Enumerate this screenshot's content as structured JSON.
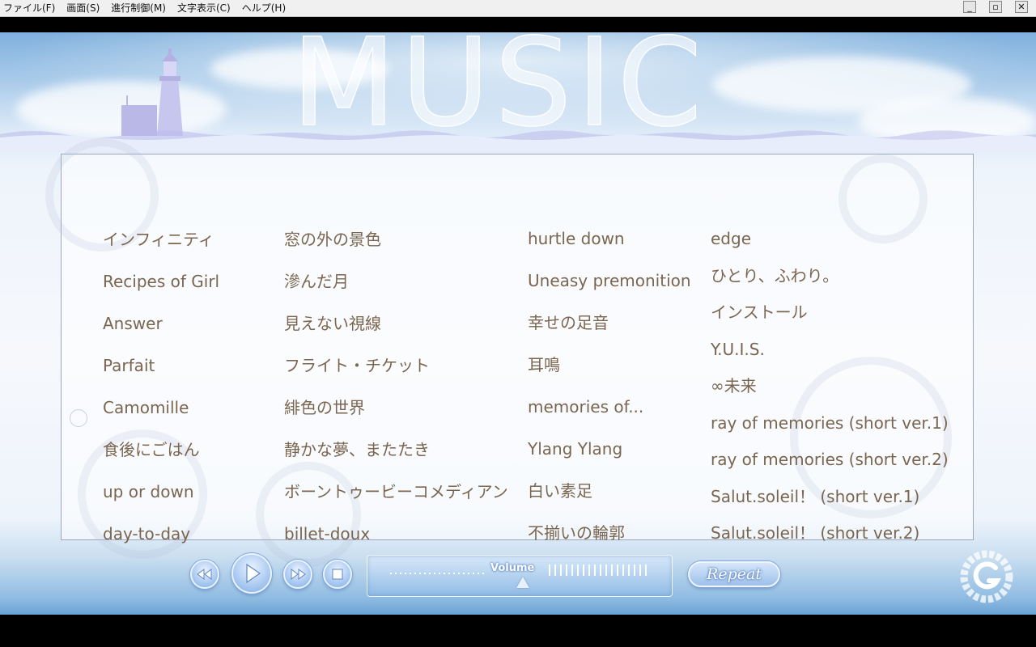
{
  "menubar": {
    "items": [
      "ファイル(F)",
      "画面(S)",
      "進行制御(M)",
      "文字表示(C)",
      "ヘルプ(H)"
    ],
    "controls": {
      "minimize": "_",
      "restore": "▫",
      "close": "✕"
    }
  },
  "header": {
    "title": "MUSIC"
  },
  "tracks": {
    "column1": [
      "インフィニティ",
      "Recipes of Girl",
      "Answer",
      "Parfait",
      "Camomille",
      "食後にごはん",
      "up or down",
      "day-to-day"
    ],
    "column2": [
      "窓の外の景色",
      "滲んだ月",
      "見えない視線",
      "フライト・チケット",
      "緋色の世界",
      "静かな夢、またたき",
      "ボーントゥービーコメディアン",
      "billet-doux"
    ],
    "column3": [
      "hurtle down",
      "Uneasy premonition",
      "幸せの足音",
      "耳鳴",
      "memories of...",
      "Ylang Ylang",
      "白い素足",
      "不揃いの輪郭"
    ],
    "column4": [
      "edge",
      "ひとり、ふわり。",
      "インストール",
      "Y.U.I.S.",
      "∞未来",
      "ray of memories (short ver.1)",
      "ray of memories (short ver.2)",
      "Salut.soleil！ (short ver.1)",
      "Salut.soleil！ (short ver.2)"
    ]
  },
  "player": {
    "volume_label": "Volume",
    "repeat_label": "Repeat",
    "volume_level": 0.51,
    "icons": {
      "rewind": "rewind-icon",
      "play": "play-icon",
      "fast_forward": "fast-forward-icon",
      "stop": "stop-icon"
    }
  },
  "colors": {
    "track_text": "#7a6650",
    "accent": "#9fc2ee",
    "panel_border": "#9aa6bd"
  }
}
